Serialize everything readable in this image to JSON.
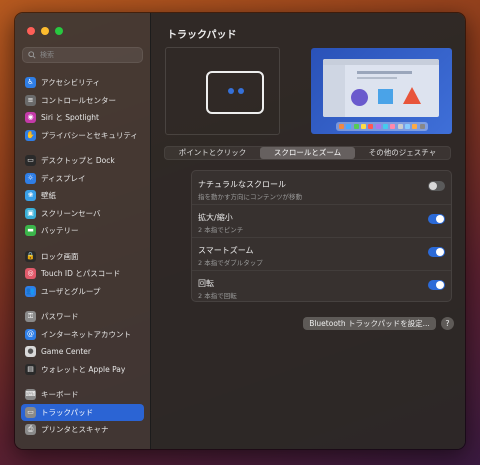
{
  "search": {
    "placeholder": "検索"
  },
  "colors": {
    "accent": "#2b64d4",
    "toggle_on": "#2b6ad8",
    "toggle_off": "#5a5a5a"
  },
  "sidebar": {
    "groups": [
      [
        {
          "label": "アクセシビリティ",
          "icon": "accessibility-icon",
          "color": "#2f7ee6",
          "glyph": "♿"
        },
        {
          "label": "コントロールセンター",
          "icon": "control-center-icon",
          "color": "#6b6b6b",
          "glyph": "≡"
        },
        {
          "label": "Siri と Spotlight",
          "icon": "siri-icon",
          "color": "#c43aa8",
          "glyph": "◉"
        },
        {
          "label": "プライバシーとセキュリティ",
          "icon": "hand-icon",
          "color": "#2f7ee6",
          "glyph": "✋"
        }
      ],
      [
        {
          "label": "デスクトップと Dock",
          "icon": "desktop-dock-icon",
          "color": "#2a2a2a",
          "glyph": "▭"
        },
        {
          "label": "ディスプレイ",
          "icon": "display-icon",
          "color": "#2f7ee6",
          "glyph": "☼"
        },
        {
          "label": "壁紙",
          "icon": "wallpaper-icon",
          "color": "#39a0e8",
          "glyph": "❀"
        },
        {
          "label": "スクリーンセーバ",
          "icon": "screensaver-icon",
          "color": "#3ab0d8",
          "glyph": "▣"
        },
        {
          "label": "バッテリー",
          "icon": "battery-icon",
          "color": "#3bb54a",
          "glyph": "▬"
        }
      ],
      [
        {
          "label": "ロック画面",
          "icon": "lock-screen-icon",
          "color": "#2a2a2a",
          "glyph": "🔒"
        },
        {
          "label": "Touch ID とパスコード",
          "icon": "fingerprint-icon",
          "color": "#e05a6a",
          "glyph": "◎"
        },
        {
          "label": "ユーザとグループ",
          "icon": "users-icon",
          "color": "#2f7ee6",
          "glyph": "👥"
        }
      ],
      [
        {
          "label": "パスワード",
          "icon": "key-icon",
          "color": "#8a8a8a",
          "glyph": "⚿"
        },
        {
          "label": "インターネットアカウント",
          "icon": "at-icon",
          "color": "#2f7ee6",
          "glyph": "@"
        },
        {
          "label": "Game Center",
          "icon": "game-center-icon",
          "color": "#d9d9d9",
          "glyph": "●"
        },
        {
          "label": "ウォレットと Apple Pay",
          "icon": "wallet-icon",
          "color": "#2a2a2a",
          "glyph": "▤"
        }
      ],
      [
        {
          "label": "キーボード",
          "icon": "keyboard-icon",
          "color": "#8a8a8a",
          "glyph": "⌨"
        },
        {
          "label": "トラックパッド",
          "icon": "trackpad-icon",
          "color": "#8a8a8a",
          "glyph": "▭",
          "active": true
        },
        {
          "label": "プリンタとスキャナ",
          "icon": "printer-icon",
          "color": "#8a8a8a",
          "glyph": "⎙"
        }
      ]
    ]
  },
  "main": {
    "title": "トラックパッド",
    "tabs": [
      {
        "label": "ポイントとクリック",
        "active": false
      },
      {
        "label": "スクロールとズーム",
        "active": true
      },
      {
        "label": "その他のジェスチャ",
        "active": false
      }
    ],
    "settings": [
      {
        "label": "ナチュラルなスクロール",
        "sub": "指を動かす方向にコンテンツが移動",
        "on": false
      },
      {
        "label": "拡大/縮小",
        "sub": "2 本指でピンチ",
        "on": true
      },
      {
        "label": "スマートズーム",
        "sub": "2 本指でダブルタップ",
        "on": true
      },
      {
        "label": "回転",
        "sub": "2 本指で回転",
        "on": true
      }
    ],
    "bt_button": "Bluetooth トラックパッドを設定...",
    "help": "?"
  }
}
